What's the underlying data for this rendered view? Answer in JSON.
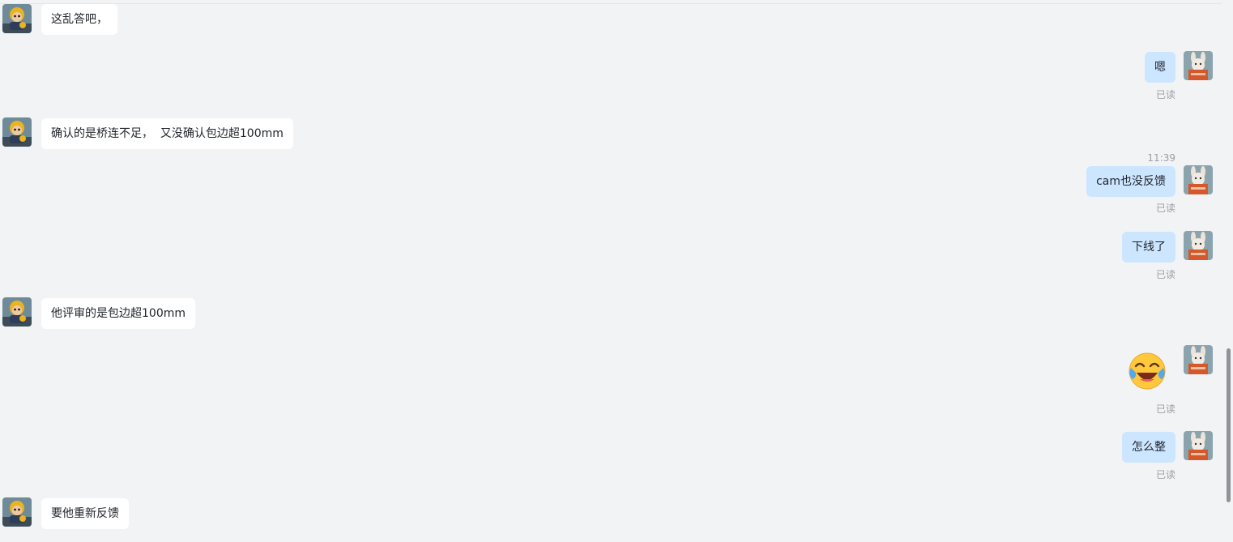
{
  "messages": {
    "m1": {
      "text": "这乱答吧，",
      "direction": "incoming"
    },
    "m2": {
      "text": "嗯",
      "direction": "outgoing",
      "status": "已读"
    },
    "m3": {
      "text": "确认的是桥连不足，  又没确认包边超100mm",
      "direction": "incoming"
    },
    "m4": {
      "text": "cam也没反馈",
      "direction": "outgoing",
      "status": "已读",
      "time": "11:39"
    },
    "m5": {
      "text": "下线了",
      "direction": "outgoing",
      "status": "已读"
    },
    "m6": {
      "text": "他评审的是包边超100mm",
      "direction": "incoming"
    },
    "m7": {
      "emoji": "crying-laughing-emoji",
      "direction": "outgoing",
      "status": "已读"
    },
    "m8": {
      "text": "怎么整",
      "direction": "outgoing",
      "status": "已读"
    },
    "m9": {
      "text": "要他重新反馈",
      "direction": "incoming"
    }
  },
  "colors": {
    "background": "#f2f3f5",
    "incoming_bubble": "#ffffff",
    "outgoing_bubble": "#cce6ff",
    "meta_text": "#9aa0a6"
  }
}
